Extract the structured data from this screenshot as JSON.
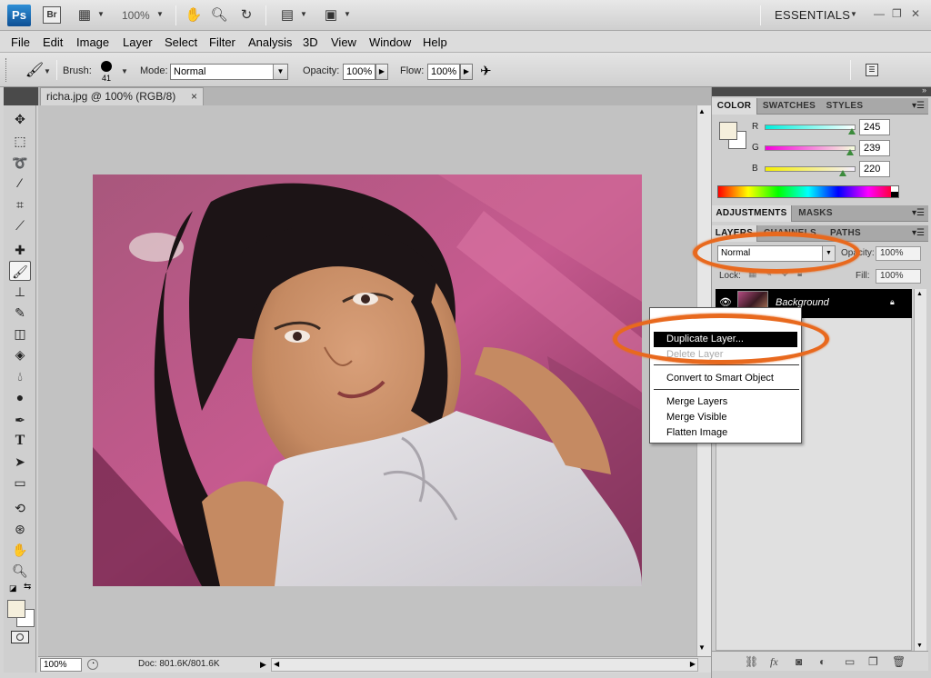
{
  "appbar": {
    "ps_logo": "Ps",
    "br_logo": "Br",
    "zoom": "100%",
    "workspace": "ESSENTIALS",
    "icons": [
      "view-extras-icon",
      "hand-icon",
      "zoom-icon",
      "rotate-view-icon",
      "arrange-documents-icon",
      "screen-mode-icon"
    ]
  },
  "menu": [
    "File",
    "Edit",
    "Image",
    "Layer",
    "Select",
    "Filter",
    "Analysis",
    "3D",
    "View",
    "Window",
    "Help"
  ],
  "options": {
    "brush_label": "Brush:",
    "brush_size": "41",
    "mode_label": "Mode:",
    "mode_value": "Normal",
    "opacity_label": "Opacity:",
    "opacity_value": "100%",
    "flow_label": "Flow:",
    "flow_value": "100%"
  },
  "document": {
    "tab_title": "richa.jpg @ 100% (RGB/8)",
    "tab_close": "×",
    "status_zoom": "100%",
    "status_info": "Doc: 801.6K/801.6K"
  },
  "color_panel": {
    "tabs": [
      "COLOR",
      "SWATCHES",
      "STYLES"
    ],
    "r_label": "R",
    "r_value": "245",
    "r_fraction": 0.96,
    "g_label": "G",
    "g_value": "239",
    "g_fraction": 0.94,
    "b_label": "B",
    "b_value": "220",
    "b_fraction": 0.86,
    "foreground": "#f5efdc"
  },
  "adjust_panel": {
    "tabs": [
      "ADJUSTMENTS",
      "MASKS"
    ]
  },
  "layers_panel": {
    "tabs": [
      "LAYERS",
      "CHANNELS",
      "PATHS"
    ],
    "blend_mode": "Normal",
    "opacity_label": "Opacity:",
    "opacity_value": "100%",
    "lock_label": "Lock:",
    "fill_label": "Fill:",
    "fill_value": "100%",
    "layer_name": "Background"
  },
  "context_menu": {
    "items": [
      "Duplicate Layer...",
      "Delete Layer",
      "Convert to Smart Object",
      "Merge Layers",
      "Merge Visible",
      "Flatten Image"
    ]
  },
  "colors": {
    "highlight_ellipse": "#e8691e",
    "accent": "#000000"
  }
}
